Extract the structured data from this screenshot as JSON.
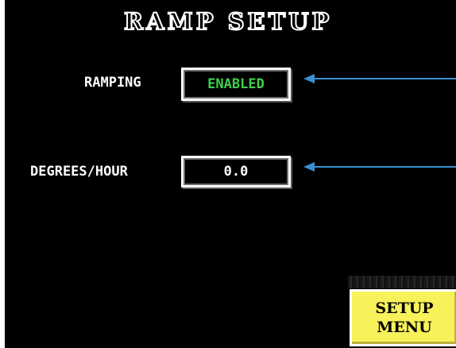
{
  "screen": {
    "title": "RAMP SETUP"
  },
  "ramping": {
    "label": "RAMPING",
    "value": "ENABLED",
    "value_color": "#3fd14a"
  },
  "degrees_per_hour": {
    "label": "DEGREES/HOUR",
    "value": "0.0",
    "value_color": "#ffffff"
  },
  "setup_menu_button": {
    "line1": "SETUP",
    "line2": "MENU",
    "color": "#f7f25a"
  },
  "annotation_color": "#3a8fd0"
}
